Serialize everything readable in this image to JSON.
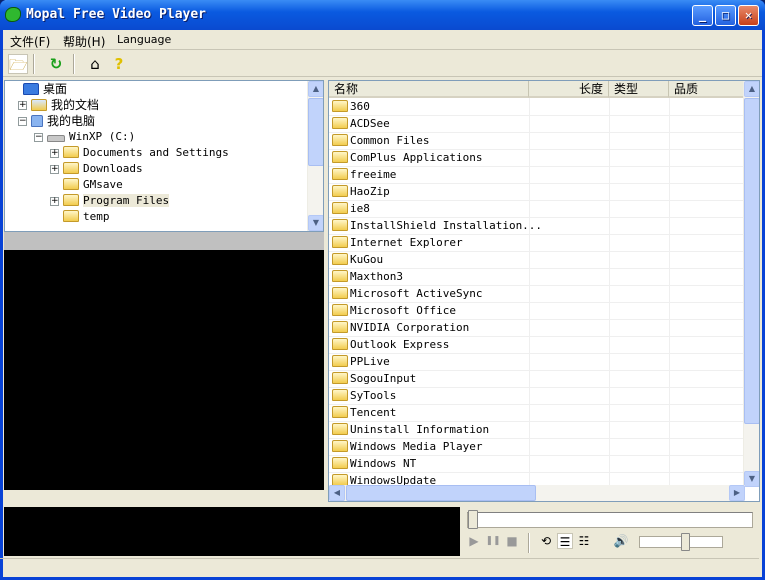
{
  "window": {
    "title": "Mopal Free Video Player",
    "minimize": "_",
    "maximize": "□",
    "close": "✕"
  },
  "menu": {
    "items": [
      {
        "label": "文件(F)"
      },
      {
        "label": "帮助(H)"
      },
      {
        "label": "Language"
      }
    ]
  },
  "toolbar": {
    "icons": [
      "open-folder-icon",
      "refresh-icon",
      "home-icon",
      "help-icon"
    ]
  },
  "tree": {
    "nodes": [
      {
        "label": "桌面",
        "level": 0,
        "icon": "desktop-icon",
        "expander": ""
      },
      {
        "label": "我的文档",
        "level": 1,
        "icon": "documents-icon",
        "expander": "+"
      },
      {
        "label": "我的电脑",
        "level": 1,
        "icon": "computer-icon",
        "expander": "-"
      },
      {
        "label": "WinXP (C:)",
        "level": 2,
        "icon": "drive-icon",
        "expander": "-"
      },
      {
        "label": "Documents and Settings",
        "level": 3,
        "icon": "folder-icon",
        "expander": "+"
      },
      {
        "label": "Downloads",
        "level": 3,
        "icon": "folder-icon",
        "expander": "+"
      },
      {
        "label": "GMsave",
        "level": 3,
        "icon": "folder-icon",
        "expander": ""
      },
      {
        "label": "Program Files",
        "level": 3,
        "icon": "folder-icon",
        "expander": "+",
        "selected": true
      },
      {
        "label": "temp",
        "level": 3,
        "icon": "folder-icon",
        "expander": ""
      }
    ]
  },
  "list": {
    "columns": [
      "名称",
      "长度",
      "类型",
      "品质"
    ],
    "files": [
      "360",
      "ACDSee",
      "Common Files",
      "ComPlus Applications",
      "freeime",
      "HaoZip",
      "ie8",
      "InstallShield Installation...",
      "Internet Explorer",
      "KuGou",
      "Maxthon3",
      "Microsoft ActiveSync",
      "Microsoft Office",
      "NVIDIA Corporation",
      "Outlook Express",
      "PPLive",
      "SogouInput",
      "SyTools",
      "Tencent",
      "Uninstall Information",
      "Windows Media Player",
      "Windows NT",
      "WindowsUpdate"
    ]
  },
  "controls": {
    "play": "▶",
    "pause": "❚❚",
    "stop": "■",
    "repeat": "⟲",
    "playlist": "☰",
    "playlist2": "☷",
    "volume_icon": "🔊",
    "seek_percent": 0,
    "volume_percent": 55
  },
  "colors": {
    "titlebar": "#0a5ae0",
    "window_bg": "#ece9d8",
    "video_bg": "#000000",
    "selection": "#ece9d8"
  }
}
